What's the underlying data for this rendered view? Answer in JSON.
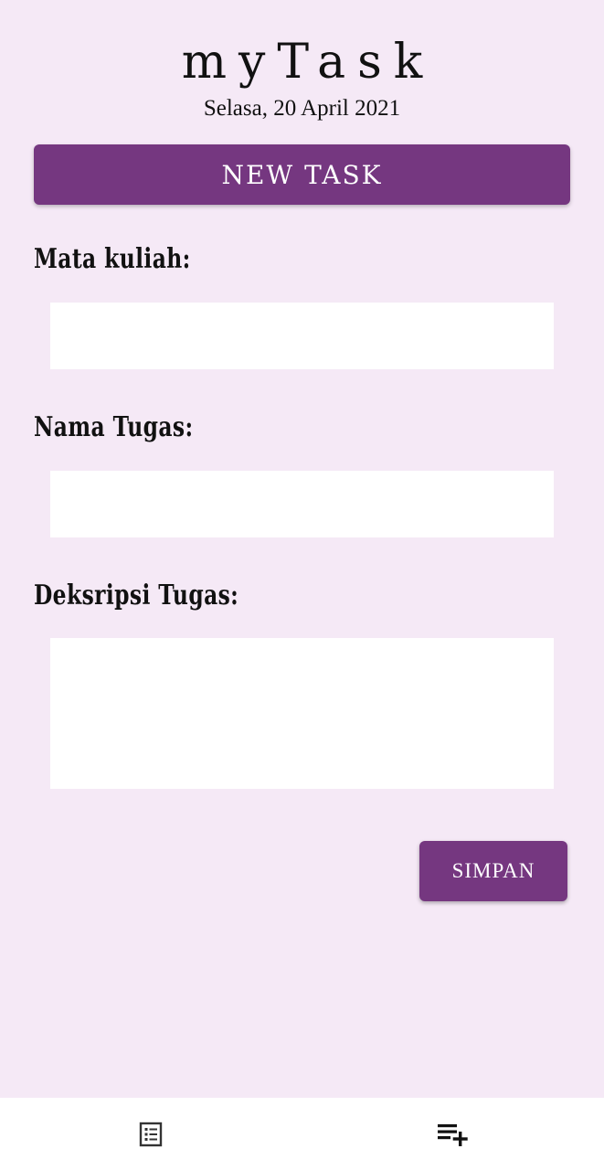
{
  "header": {
    "title": "myTask",
    "date": "Selasa, 20 April 2021"
  },
  "banner": {
    "label": "NEW TASK"
  },
  "form": {
    "mata_kuliah_label": "Mata kuliah:",
    "mata_kuliah_value": "",
    "nama_tugas_label": "Nama Tugas:",
    "nama_tugas_value": "",
    "deskripsi_label": "Deksripsi Tugas:",
    "deskripsi_value": "",
    "save_label": "SIMPAN"
  },
  "bottom_nav": {
    "items": [
      {
        "icon": "task-list-icon"
      },
      {
        "icon": "playlist-add-icon"
      }
    ]
  },
  "colors": {
    "accent": "#753780",
    "background": "#f5e9f6",
    "nav_background": "#ffffff"
  }
}
